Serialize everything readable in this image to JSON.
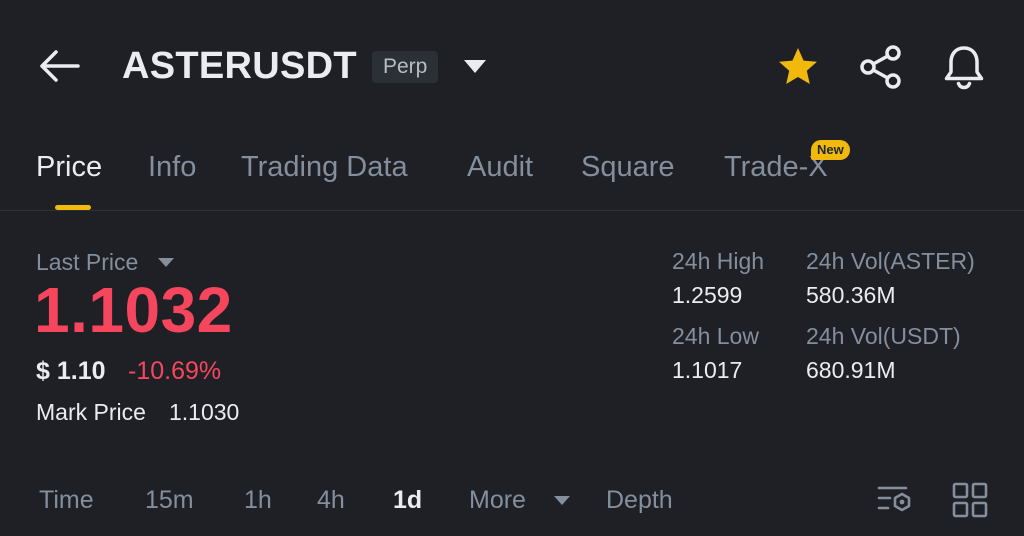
{
  "header": {
    "back_icon": "arrow-left-icon",
    "pair": "ASTERUSDT",
    "contract_type": "Perp",
    "dropdown_icon": "caret-down-icon",
    "favorite_icon": "star-icon",
    "share_icon": "share-icon",
    "alert_icon": "bell-icon"
  },
  "tabs": [
    {
      "label": "Price",
      "active": true
    },
    {
      "label": "Info"
    },
    {
      "label": "Trading Data"
    },
    {
      "label": "Audit"
    },
    {
      "label": "Square"
    },
    {
      "label": "Trade-X",
      "badge": "New"
    }
  ],
  "price": {
    "label": "Last Price",
    "last": "1.1032",
    "usd": "$ 1.10",
    "change": "-10.69%",
    "mark_label": "Mark Price",
    "mark_value": "1.1030"
  },
  "stats": {
    "high_label": "24h High",
    "high": "1.2599",
    "low_label": "24h Low",
    "low": "1.1017",
    "vol_base_label": "24h Vol(ASTER)",
    "vol_base": "580.36M",
    "vol_quote_label": "24h Vol(USDT)",
    "vol_quote": "680.91M"
  },
  "intervals": {
    "time": "Time",
    "m15": "15m",
    "h1": "1h",
    "h4": "4h",
    "d1": "1d",
    "more": "More",
    "depth": "Depth",
    "active": "1d",
    "settings_icon": "chart-settings-icon",
    "layout_icon": "grid-icon"
  },
  "colors": {
    "background": "#1e2026",
    "accent": "#f0b90b",
    "negative": "#f6465d",
    "muted": "#848e9c",
    "text": "#eaecef"
  }
}
